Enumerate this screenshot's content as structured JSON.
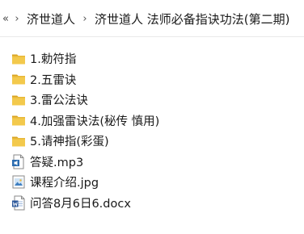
{
  "breadcrumb": {
    "overflow_glyph": "«",
    "separator_glyph": "›",
    "items": [
      "济世道人",
      "济世道人 法师必备指诀功法(第二期)"
    ]
  },
  "files": [
    {
      "name": "1.勅符指",
      "type": "folder",
      "icon": "folder-icon"
    },
    {
      "name": "2.五雷诀",
      "type": "folder",
      "icon": "folder-icon"
    },
    {
      "name": "3.雷公法诀",
      "type": "folder",
      "icon": "folder-icon"
    },
    {
      "name": "4.加强雷诀法(秘传 慎用)",
      "type": "folder",
      "icon": "folder-icon"
    },
    {
      "name": "5.请神指(彩蛋)",
      "type": "folder",
      "icon": "folder-icon"
    },
    {
      "name": "答疑.mp3",
      "type": "audio",
      "icon": "audio-file-icon"
    },
    {
      "name": "课程介绍.jpg",
      "type": "image",
      "icon": "image-file-icon"
    },
    {
      "name": "问答8月6日6.docx",
      "type": "document",
      "icon": "word-document-icon"
    }
  ],
  "colors": {
    "folder": "#e8b839",
    "folder_tab": "#d9a423",
    "audio_accent": "#2b6cb0",
    "word_blue": "#2b579a"
  }
}
